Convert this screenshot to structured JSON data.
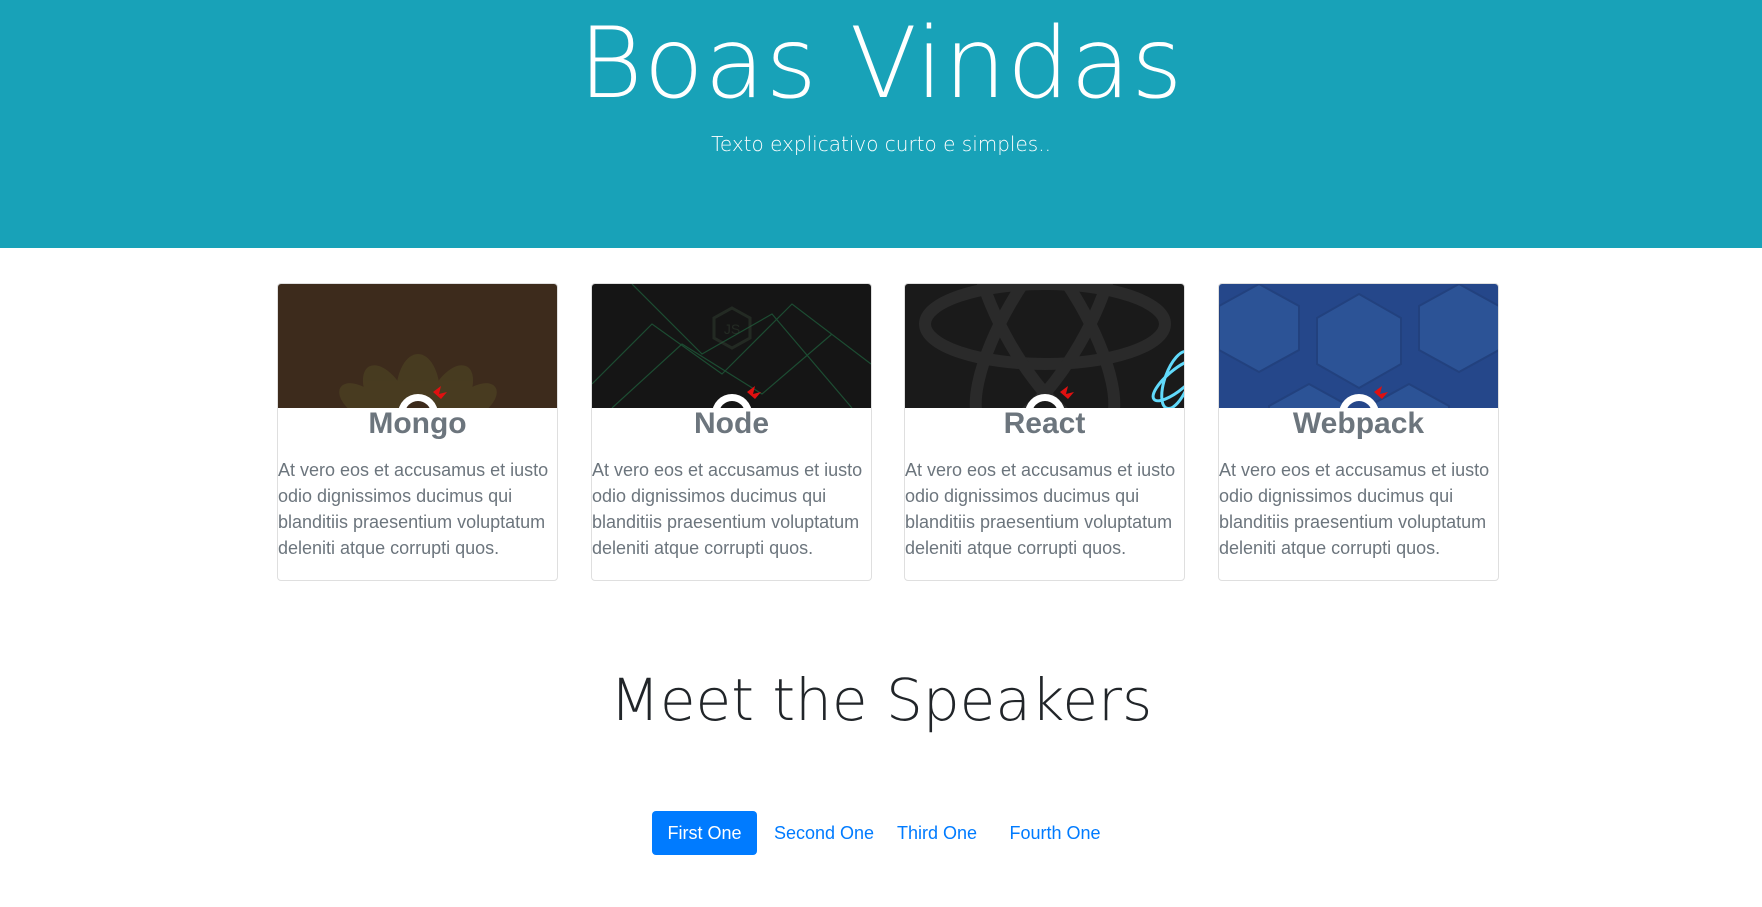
{
  "hero": {
    "title": "Boas Vindas",
    "subtitle": "Texto explicativo curto e simples.."
  },
  "cards": [
    {
      "title": "Mongo",
      "text": "At vero eos et accusamus et iusto odio dignissimos ducimus qui blanditiis praesentium voluptatum deleniti atque corrupti quos.",
      "image_color": "#3d2b1c",
      "image_icon": "leaf-logo-icon"
    },
    {
      "title": "Node",
      "text": "At vero eos et accusamus et iusto odio dignissimos ducimus qui blanditiis praesentium voluptatum deleniti atque corrupti quos.",
      "image_color": "#151515",
      "image_icon": "nodejs-hexagon-icon"
    },
    {
      "title": "React",
      "text": "At vero eos et accusamus et iusto odio dignissimos ducimus qui blanditiis praesentium voluptatum deleniti atque corrupti quos.",
      "image_color": "#1a1a1a",
      "image_icon": "react-atom-icon"
    },
    {
      "title": "Webpack",
      "text": "At vero eos et accusamus et iusto odio dignissimos ducimus qui blanditiis praesentium voluptatum deleniti atque corrupti quos.",
      "image_color": "#25478a",
      "image_icon": "webpack-cube-icon"
    }
  ],
  "speakers": {
    "title": "Meet the Speakers",
    "tabs": [
      "First One",
      "Second One",
      "Third One",
      "Fourth One"
    ],
    "active_tab": "First One"
  },
  "colors": {
    "hero_bg": "#18a2b8",
    "primary": "#007bff",
    "muted_text": "#6c757d"
  }
}
